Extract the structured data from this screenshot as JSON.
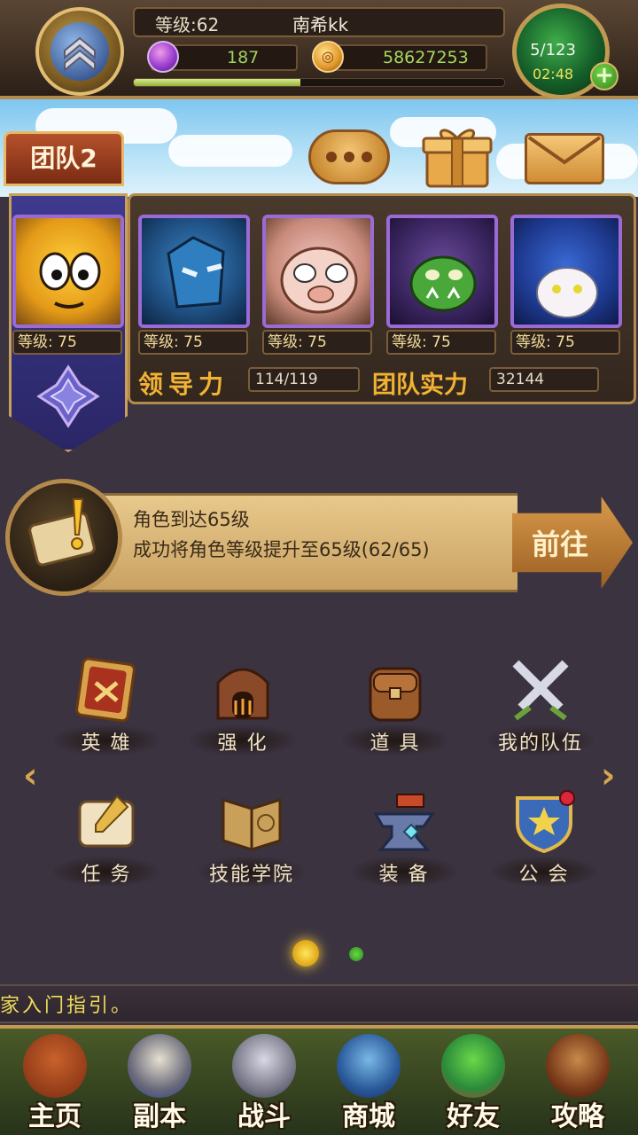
{
  "hud": {
    "level_label": "等级:62",
    "player_name": "南希kk",
    "gems": "187",
    "gold": "58627253",
    "exp_fraction": 0.45,
    "energy": "5/123",
    "energy_timer": "02:48",
    "plus_label": "+"
  },
  "team": {
    "tab_label": "团队2",
    "heroes": [
      {
        "level": "等级: 75",
        "icon": "yellow-blob-hero-portrait"
      },
      {
        "level": "等级: 75",
        "icon": "blue-warrior-hero-portrait"
      },
      {
        "level": "等级: 75",
        "icon": "pig-hero-portrait"
      },
      {
        "level": "等级: 75",
        "icon": "green-orc-hero-portrait"
      },
      {
        "level": "等级: 75",
        "icon": "blue-hair-hero-portrait"
      }
    ],
    "leadership_label": "领导力",
    "leadership_value": "114/119",
    "power_label": "团队实力",
    "power_value": "32144"
  },
  "quest": {
    "title": "角色到达65级",
    "description": "成功将角色等级提升至65级(62/65)",
    "goto_label": "前往"
  },
  "menu": {
    "row1": [
      {
        "label": "英  雄",
        "icon": "hero-card-icon"
      },
      {
        "label": "强  化",
        "icon": "forge-icon"
      },
      {
        "label": "道  具",
        "icon": "backpack-icon"
      },
      {
        "label": "我的队伍",
        "icon": "crossed-swords-icon"
      }
    ],
    "row2": [
      {
        "label": "任  务",
        "icon": "scroll-icon"
      },
      {
        "label": "技能学院",
        "icon": "spellbook-icon"
      },
      {
        "label": "装  备",
        "icon": "anvil-icon"
      },
      {
        "label": "公  会",
        "icon": "guild-shield-icon"
      }
    ],
    "prev_arrow": "‹",
    "next_arrow": "›"
  },
  "ticker": {
    "text": "家入门指引。"
  },
  "nav": [
    {
      "label": "主页",
      "icon": "home-hut-icon"
    },
    {
      "label": "副本",
      "icon": "skull-dungeon-icon"
    },
    {
      "label": "战斗",
      "icon": "battle-axe-icon"
    },
    {
      "label": "商城",
      "icon": "shop-monster-icon"
    },
    {
      "label": "好友",
      "icon": "friends-goblin-icon"
    },
    {
      "label": "攻略",
      "icon": "guide-book-icon"
    }
  ],
  "colors": {
    "accent_gold": "#f2b233",
    "hero_frame": "#9a6ad6",
    "gem_text": "#9fd35a",
    "ticker_text": "#f0dc56"
  }
}
